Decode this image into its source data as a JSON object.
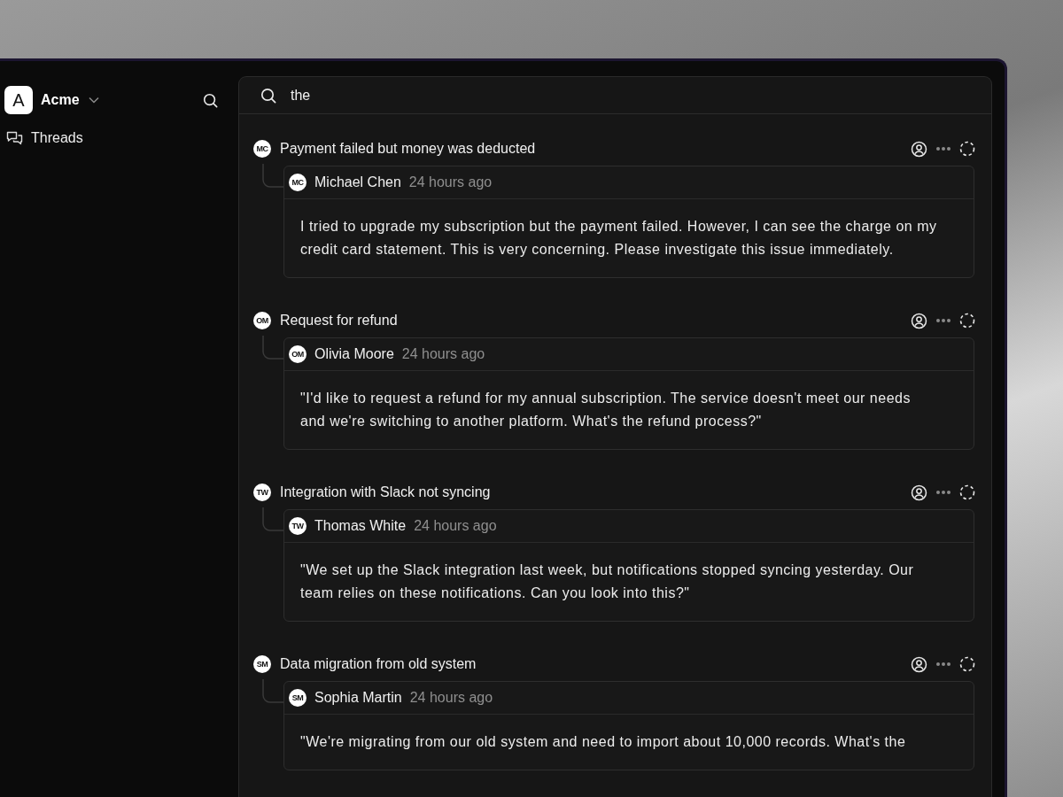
{
  "workspace": {
    "logo": "A",
    "name": "Acme"
  },
  "nav": [
    {
      "label": "Threads"
    }
  ],
  "search": {
    "value": "the"
  },
  "threads": [
    {
      "initials": "MC",
      "title": "Payment failed but money was deducted",
      "author_initials": "MC",
      "author": "Michael Chen",
      "time": "24 hours ago",
      "lines": [
        "I tried to upgrade my subscription but the payment failed. However, I can see the charge on my credit card statement. This is very concerning. Please investigate this issue immediately."
      ]
    },
    {
      "initials": "OM",
      "title": "Request for refund",
      "author_initials": "OM",
      "author": "Olivia Moore",
      "time": "24 hours ago",
      "lines": [
        "\"I'd like to request a refund for my annual subscription. The service doesn't meet our needs and we're switching to another platform. What's the refund process?\""
      ]
    },
    {
      "initials": "TW",
      "title": "Integration with Slack not syncing",
      "author_initials": "TW",
      "author": "Thomas White",
      "time": "24 hours ago",
      "lines": [
        "\"We set up the Slack integration last week, but notifications stopped syncing yesterday. Our team relies on these notifications. Can you look into this?\""
      ]
    },
    {
      "initials": "SM",
      "title": "Data migration from old system",
      "author_initials": "SM",
      "author": "Sophia Martin",
      "time": "24 hours ago",
      "lines": [
        "\"We're migrating from our old system and need to import about 10,000 records. What's the"
      ]
    }
  ]
}
